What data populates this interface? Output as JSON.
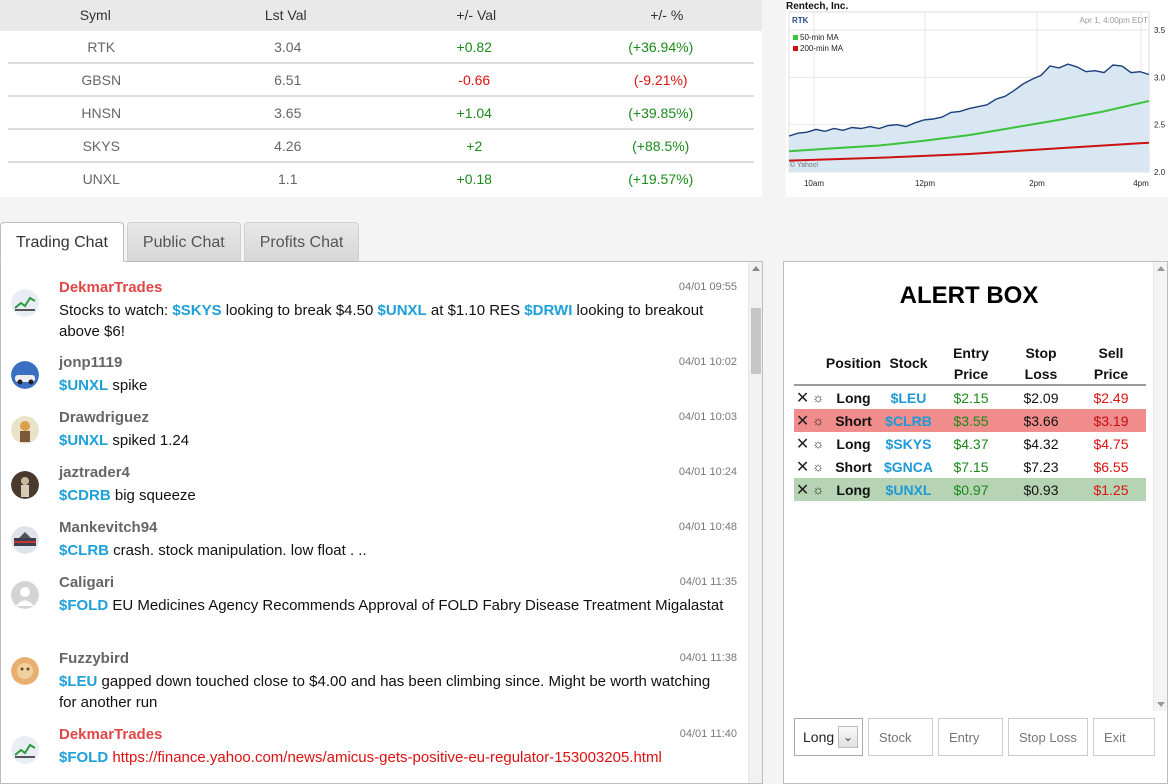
{
  "quotes": {
    "headers": [
      "Syml",
      "Lst Val",
      "+/- Val",
      "+/- %"
    ],
    "rows": [
      {
        "sym": "RTK",
        "last": "3.04",
        "chg": "+0.82",
        "pct": "(+36.94%)",
        "dir": "pos"
      },
      {
        "sym": "GBSN",
        "last": "6.51",
        "chg": "-0.66",
        "pct": "(-9.21%)",
        "dir": "neg"
      },
      {
        "sym": "HNSN",
        "last": "3.65",
        "chg": "+1.04",
        "pct": "(+39.85%)",
        "dir": "pos"
      },
      {
        "sym": "SKYS",
        "last": "4.26",
        "chg": "+2",
        "pct": "(+88.5%)",
        "dir": "pos"
      },
      {
        "sym": "UNXL",
        "last": "1.1",
        "chg": "+0.18",
        "pct": "(+19.57%)",
        "dir": "pos"
      }
    ]
  },
  "chart": {
    "company": "Rentech, Inc.",
    "ticker": "RTK",
    "timestamp": "Apr 1, 4:00pm EDT",
    "legend_50": "50-min MA",
    "legend_200": "200-min MA",
    "watermark": "© Yahoo!",
    "colors": {
      "price": "#1b3f7a",
      "area": "#d8e7f2",
      "ma50": "#3cc23c",
      "ma200": "#cc1111"
    }
  },
  "chart_data": {
    "type": "line",
    "x_ticks": [
      "10am",
      "12pm",
      "2pm",
      "4pm"
    ],
    "y_ticks": [
      "2.0",
      "2.5",
      "3.0",
      "3.5"
    ],
    "ylim": [
      2.0,
      3.5
    ],
    "series": [
      {
        "name": "RTK",
        "points": [
          [
            0,
            2.38
          ],
          [
            4,
            2.41
          ],
          [
            8,
            2.42
          ],
          [
            12,
            2.45
          ],
          [
            16,
            2.43
          ],
          [
            20,
            2.46
          ],
          [
            24,
            2.44
          ],
          [
            28,
            2.47
          ],
          [
            32,
            2.46
          ],
          [
            36,
            2.48
          ],
          [
            40,
            2.46
          ],
          [
            44,
            2.49
          ],
          [
            48,
            2.5
          ],
          [
            52,
            2.48
          ],
          [
            56,
            2.52
          ],
          [
            60,
            2.55
          ],
          [
            64,
            2.56
          ],
          [
            68,
            2.58
          ],
          [
            72,
            2.63
          ],
          [
            76,
            2.64
          ],
          [
            80,
            2.67
          ],
          [
            84,
            2.69
          ],
          [
            88,
            2.71
          ],
          [
            92,
            2.77
          ],
          [
            96,
            2.8
          ],
          [
            100,
            2.86
          ],
          [
            104,
            2.93
          ],
          [
            108,
            2.98
          ],
          [
            112,
            3.02
          ],
          [
            116,
            3.12
          ],
          [
            120,
            3.1
          ],
          [
            124,
            3.14
          ],
          [
            128,
            3.11
          ],
          [
            132,
            3.06
          ],
          [
            136,
            3.07
          ],
          [
            140,
            3.05
          ],
          [
            144,
            3.13
          ],
          [
            148,
            3.12
          ],
          [
            152,
            3.05
          ],
          [
            156,
            3.06
          ],
          [
            160,
            3.03
          ]
        ]
      },
      {
        "name": "50-min MA",
        "points": [
          [
            0,
            2.22
          ],
          [
            20,
            2.25
          ],
          [
            40,
            2.28
          ],
          [
            60,
            2.33
          ],
          [
            80,
            2.39
          ],
          [
            100,
            2.47
          ],
          [
            120,
            2.55
          ],
          [
            140,
            2.64
          ],
          [
            160,
            2.75
          ]
        ]
      },
      {
        "name": "200-min MA",
        "points": [
          [
            0,
            2.12
          ],
          [
            40,
            2.15
          ],
          [
            80,
            2.19
          ],
          [
            120,
            2.25
          ],
          [
            160,
            2.31
          ]
        ]
      }
    ]
  },
  "tabs": [
    {
      "label": "Trading Chat",
      "active": true
    },
    {
      "label": "Public Chat",
      "active": false
    },
    {
      "label": "Profits Chat",
      "active": false
    }
  ],
  "messages": [
    {
      "user": "DekmarTrades",
      "time": "04/01 09:55",
      "t_1": "Stocks to watch: ",
      "k_1": "$SKYS",
      "t_2": " looking to break $4.50 ",
      "k_2": "$UNXL",
      "t_3": " at $1.10 RES ",
      "k_3": "$DRWI",
      "t_4": " looking to breakout above $6!"
    },
    {
      "user": "jonp1119",
      "time": "04/01 10:02",
      "k_1": "$UNXL",
      "t_1": " spike"
    },
    {
      "user": "Drawdriguez",
      "time": "04/01 10:03",
      "k_1": "$UNXL",
      "t_1": " spiked 1.24"
    },
    {
      "user": "jaztrader4",
      "time": "04/01 10:24",
      "k_1": "$CDRB",
      "t_1": " big squeeze"
    },
    {
      "user": "Mankevitch94",
      "time": "04/01 10:48",
      "k_1": "$CLRB",
      "t_1": " crash. stock manipulation. low float . .."
    },
    {
      "user": "Caligari",
      "time": "04/01 11:35",
      "k_1": "$FOLD",
      "t_1": " EU Medicines Agency Recommends Approval of FOLD Fabry Disease Treatment Migalastat"
    },
    {
      "user": "Fuzzybird",
      "time": "04/01 11:38",
      "k_1": "$LEU",
      "t_1": " gapped down touched close to $4.00 and has been climbing since. Might be worth watching for another run"
    },
    {
      "user": "DekmarTrades",
      "time": "04/01 11:40",
      "k_1": "$FOLD",
      "link": "https://finance.yahoo.com/news/amicus-gets-positive-eu-regulator-153003205.html"
    }
  ],
  "alert": {
    "title": "ALERT BOX",
    "headers": {
      "position": "Position",
      "stock": "Stock",
      "entry_1": "Entry",
      "entry_2": "Price",
      "stop_1": "Stop",
      "stop_2": "Loss",
      "sell_1": "Sell",
      "sell_2": "Price"
    },
    "rows": [
      {
        "pos": "Long",
        "stock": "$LEU",
        "entry": "$2.15",
        "stop": "$2.09",
        "sell": "$2.49",
        "hl": ""
      },
      {
        "pos": "Short",
        "stock": "$CLRB",
        "entry": "$3.55",
        "stop": "$3.66",
        "sell": "$3.19",
        "hl": "red"
      },
      {
        "pos": "Long",
        "stock": "$SKYS",
        "entry": "$4.37",
        "stop": "$4.32",
        "sell": "$4.75",
        "hl": ""
      },
      {
        "pos": "Short",
        "stock": "$GNCA",
        "entry": "$7.15",
        "stop": "$7.23",
        "sell": "$6.55",
        "hl": ""
      },
      {
        "pos": "Long",
        "stock": "$UNXL",
        "entry": "$0.97",
        "stop": "$0.93",
        "sell": "$1.25",
        "hl": "green"
      }
    ],
    "form": {
      "position_value": "Long",
      "stock_ph": "Stock",
      "entry_ph": "Entry",
      "stop_ph": "Stop Loss",
      "exit_ph": "Exit"
    }
  }
}
